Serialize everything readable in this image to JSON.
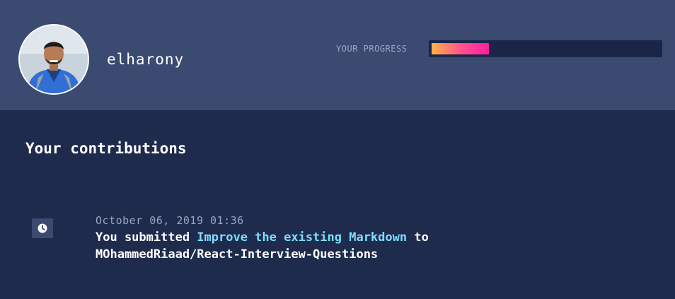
{
  "profile": {
    "username": "elharony",
    "avatar_icon": "user-avatar"
  },
  "progress": {
    "label": "YOUR PROGRESS",
    "fraction": 0.25,
    "gradient_start": "#ffb347",
    "gradient_end": "#ff1f9e"
  },
  "contributions": {
    "title": "Your contributions",
    "entries": [
      {
        "icon": "clock-icon",
        "date": "October 06, 2019 01:36",
        "prefix": "You submitted ",
        "link_text": "Improve the existing Markdown",
        "middle": " to",
        "repo": "MOhammedRiaad/React-Interview-Questions"
      }
    ]
  },
  "colors": {
    "header_bg": "#3a4a70",
    "page_bg": "#1f2b4d",
    "link": "#7fdcff"
  }
}
